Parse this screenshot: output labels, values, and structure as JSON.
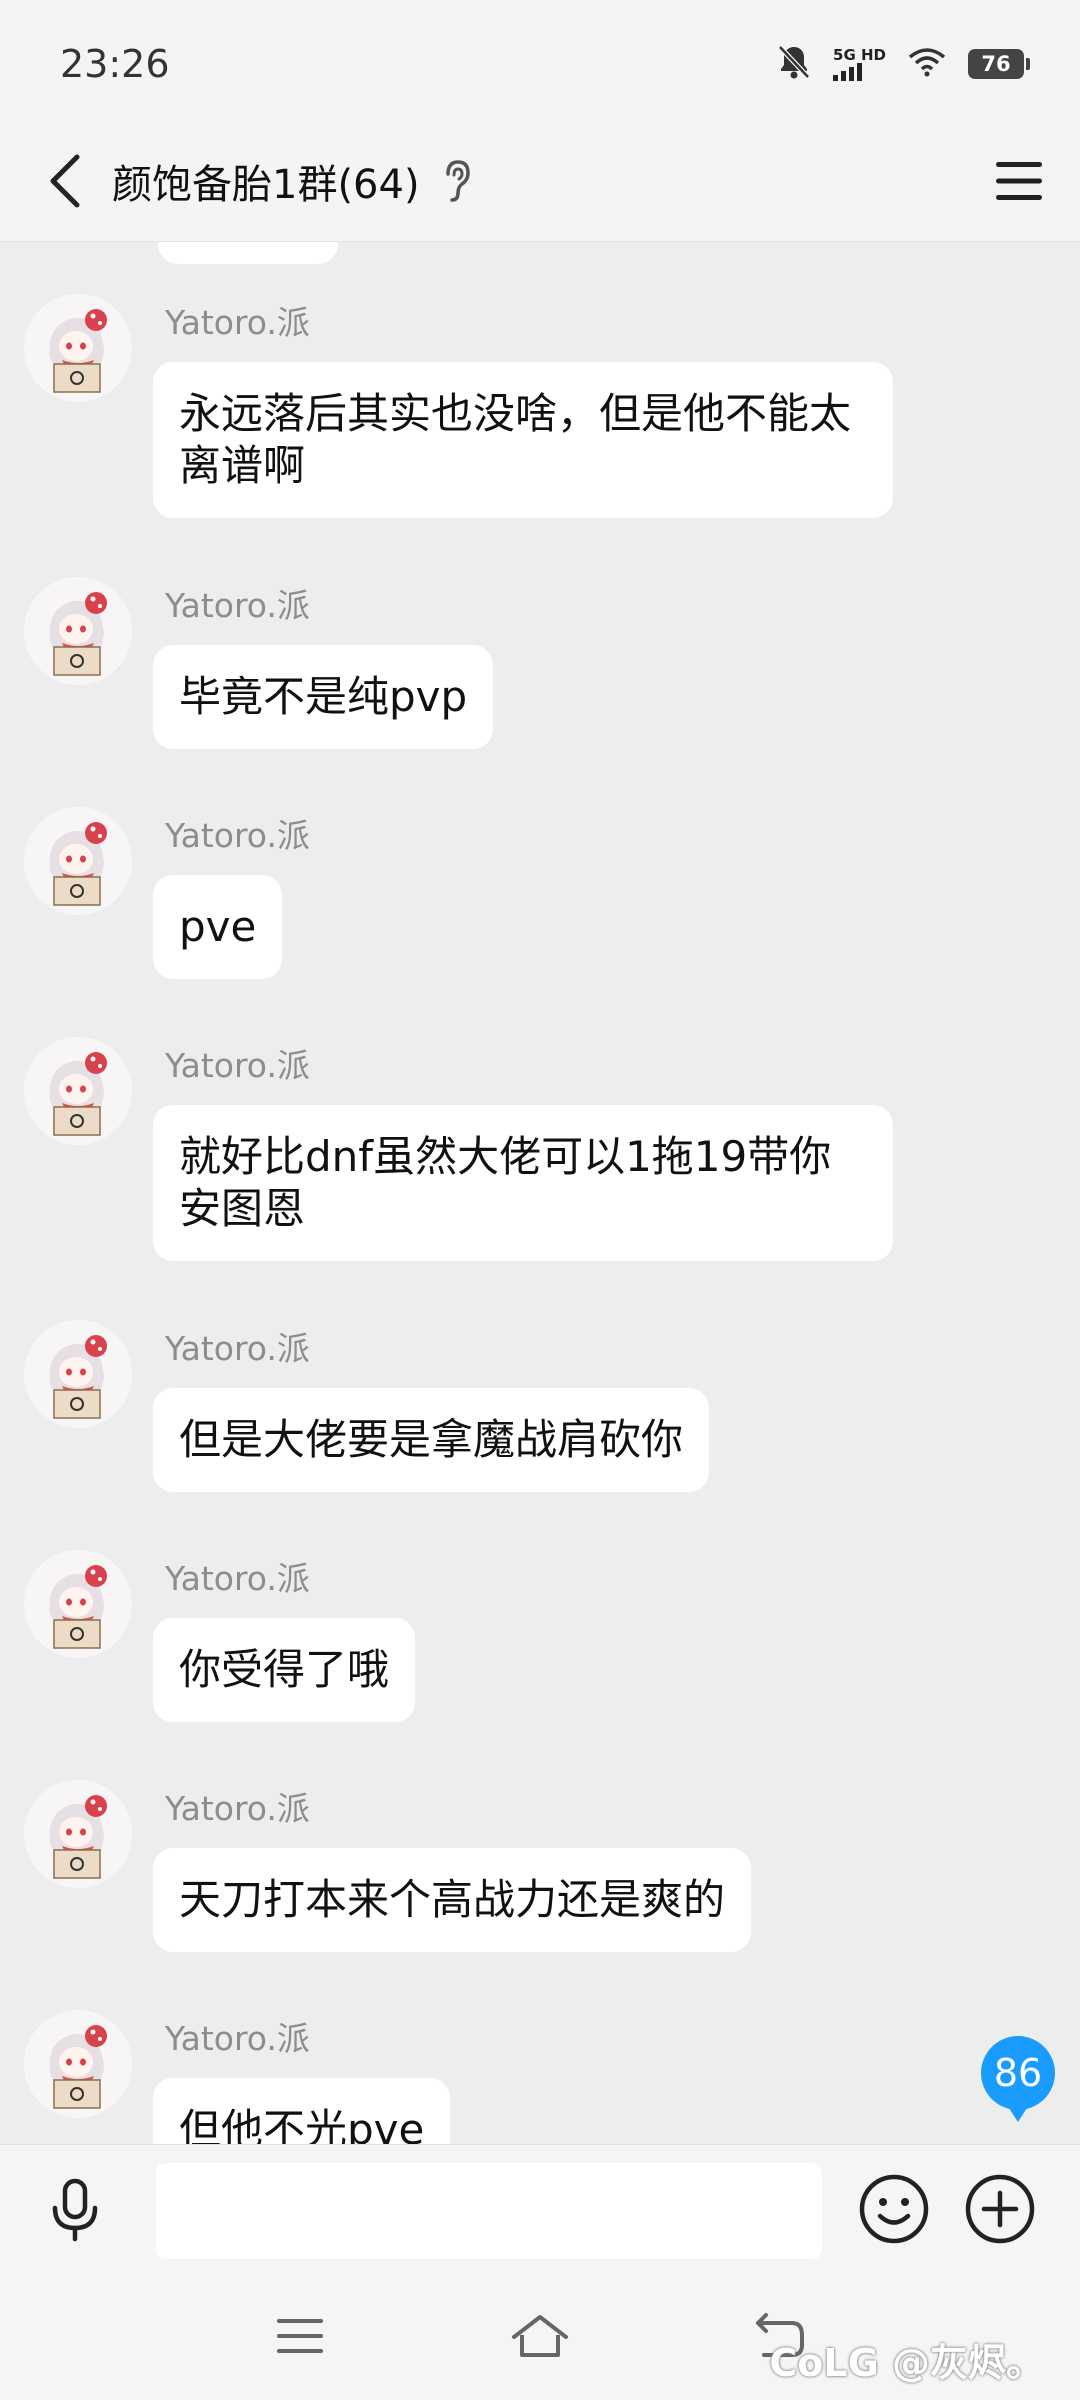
{
  "status_bar": {
    "time": "23:26",
    "network": "5G HD",
    "battery": "76"
  },
  "nav": {
    "title": "颜饱备胎1群(64)"
  },
  "messages": [
    {
      "sender": "Yatoro.派",
      "text": "永远落后其实也没啥，但是他不能太离谱啊"
    },
    {
      "sender": "Yatoro.派",
      "text": "毕竟不是纯pvp"
    },
    {
      "sender": "Yatoro.派",
      "text": "pve"
    },
    {
      "sender": "Yatoro.派",
      "text": "就好比dnf虽然大佬可以1拖19带你安图恩"
    },
    {
      "sender": "Yatoro.派",
      "text": "但是大佬要是拿魔战肩砍你"
    },
    {
      "sender": "Yatoro.派",
      "text": "你受得了哦"
    },
    {
      "sender": "Yatoro.派",
      "text": "天刀打本来个高战力还是爽的"
    },
    {
      "sender": "Yatoro.派",
      "text": "但他不光pve"
    }
  ],
  "unread_count": "86",
  "input": {
    "value": "",
    "placeholder": ""
  },
  "watermark": "CoLG @灰烬。",
  "colors": {
    "background": "#ededed",
    "bubble": "#ffffff",
    "accent": "#1a9cff",
    "sender": "#8d8d8d"
  },
  "icons": {
    "back": "chevron-left-icon",
    "listen": "ear-icon",
    "menu": "menu-icon",
    "voice": "microphone-icon",
    "emoji": "emoji-icon",
    "plus": "plus-icon",
    "sys_menu": "menu-icon",
    "sys_home": "home-icon",
    "sys_back": "back-icon"
  }
}
